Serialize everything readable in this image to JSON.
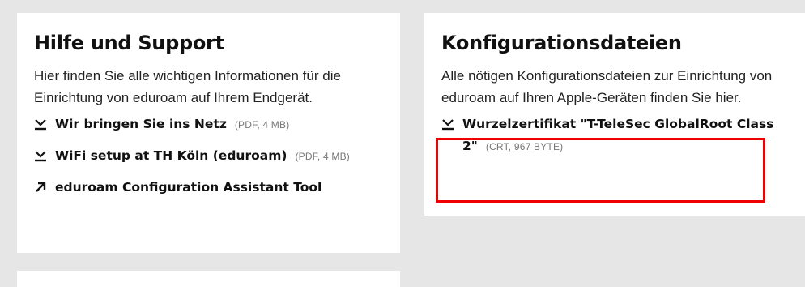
{
  "help": {
    "title": "Hilfe und Support",
    "description": "Hier finden Sie alle wichtigen Informationen für die Einrichtung von eduroam auf Ihrem Endgerät.",
    "links": [
      {
        "icon": "download-icon",
        "label": "Wir bringen Sie ins Netz",
        "meta": "(PDF, 4 MB)"
      },
      {
        "icon": "download-icon",
        "label": "WiFi setup at TH Köln (eduroam)",
        "meta": "(PDF, 4 MB)"
      },
      {
        "icon": "external-link-icon",
        "label": "eduroam Configuration Assistant Tool",
        "meta": ""
      }
    ]
  },
  "config": {
    "title": "Konfigurationsdateien",
    "description": "Alle nötigen Konfigurationsdateien zur Einrichtung von eduroam auf Ihren Apple-Geräten finden Sie hier.",
    "links": [
      {
        "icon": "download-icon",
        "label": "Wurzelzertifikat \"T-TeleSec GlobalRoot Class 2\"",
        "meta": "(CRT, 967 BYTE)"
      }
    ]
  },
  "colors": {
    "background": "#e6e6e6",
    "card": "#ffffff",
    "highlight": "#ee0000"
  }
}
